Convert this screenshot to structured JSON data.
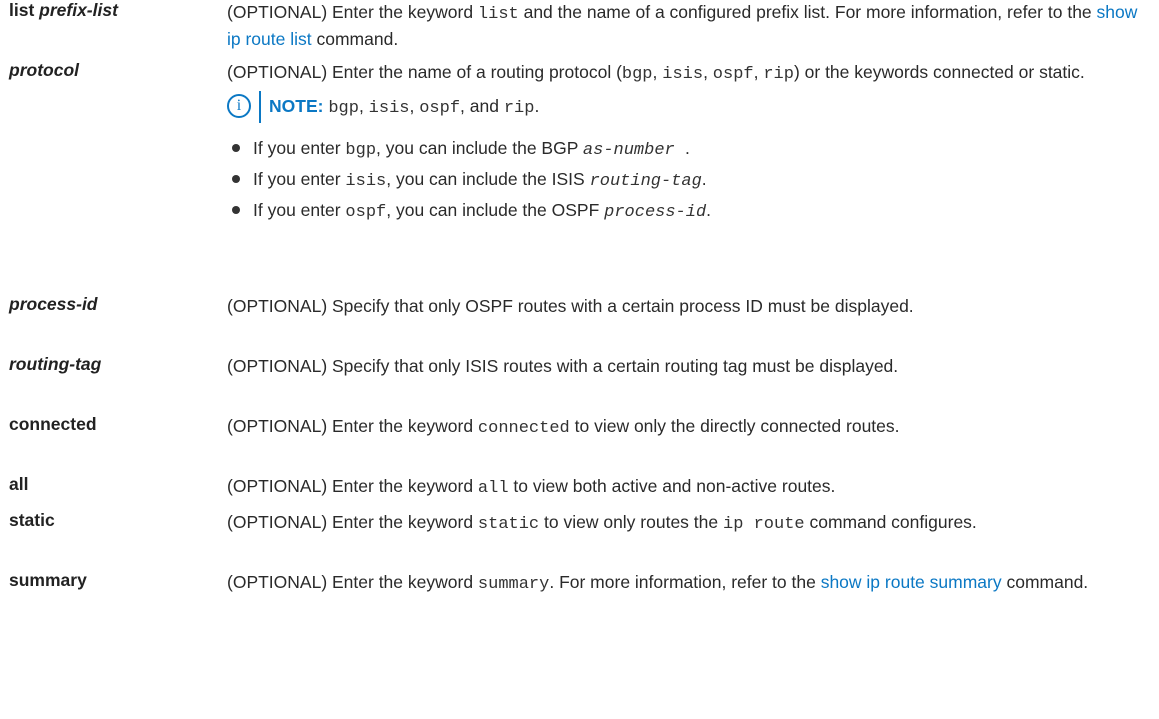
{
  "rows": {
    "list": {
      "term_a": "list ",
      "term_b": "prefix-list",
      "d1": "(OPTIONAL) Enter the keyword ",
      "d1_code": "list",
      "d2": " and the name of a configured prefix list. For more information, refer to the ",
      "link": "show ip route list",
      "d3": " command."
    },
    "protocol": {
      "term": "protocol",
      "d1": "(OPTIONAL) Enter the name of a routing protocol (",
      "c1": "bgp",
      "s1": ", ",
      "c2": "isis",
      "s2": ", ",
      "c3": "ospf",
      "s3": ", ",
      "c4": "rip",
      "d2": ") or the keywords connected or static.",
      "note": {
        "icon": "info-icon",
        "label": "NOTE:",
        "c1": "bgp",
        "s1": ", ",
        "c2": "isis",
        "s2": ", ",
        "c3": "ospf",
        "s3": ", and ",
        "c4": "rip",
        "end": "."
      },
      "bullets": [
        {
          "a": "If you enter ",
          "code": "bgp",
          "b": ", you can include the BGP ",
          "var": "as-number ",
          "c": "."
        },
        {
          "a": "If you enter ",
          "code": "isis",
          "b": ", you can include the ISIS ",
          "var": "routing-tag",
          "c": "."
        },
        {
          "a": "If you enter ",
          "code": "ospf",
          "b": ", you can include the OSPF ",
          "var": "process-id",
          "c": "."
        }
      ]
    },
    "process_id": {
      "term": "process-id",
      "desc": "(OPTIONAL) Specify that only OSPF routes with a certain process ID must be displayed."
    },
    "routing_tag": {
      "term": "routing-tag",
      "desc": "(OPTIONAL) Specify that only ISIS routes with a certain routing tag must be displayed."
    },
    "connected": {
      "term": "connected",
      "d1": "(OPTIONAL) Enter the keyword ",
      "code": "connected",
      "d2": " to view only the directly connected routes."
    },
    "all": {
      "term": "all",
      "d1": "(OPTIONAL) Enter the keyword ",
      "code": "all",
      "d2": " to view both active and non-active routes."
    },
    "static": {
      "term": "static",
      "d1": "(OPTIONAL) Enter the keyword ",
      "code": "static",
      "d2": " to view only routes the ",
      "code2": "ip route",
      "d3": " command configures."
    },
    "summary": {
      "term": "summary",
      "d1": "(OPTIONAL) Enter the keyword ",
      "code": "summary",
      "d2": ". For more information, refer to the ",
      "link": "show ip route summary",
      "d3": " command."
    }
  },
  "colors": {
    "link": "#0b78c4",
    "text": "#2a2a2a"
  }
}
